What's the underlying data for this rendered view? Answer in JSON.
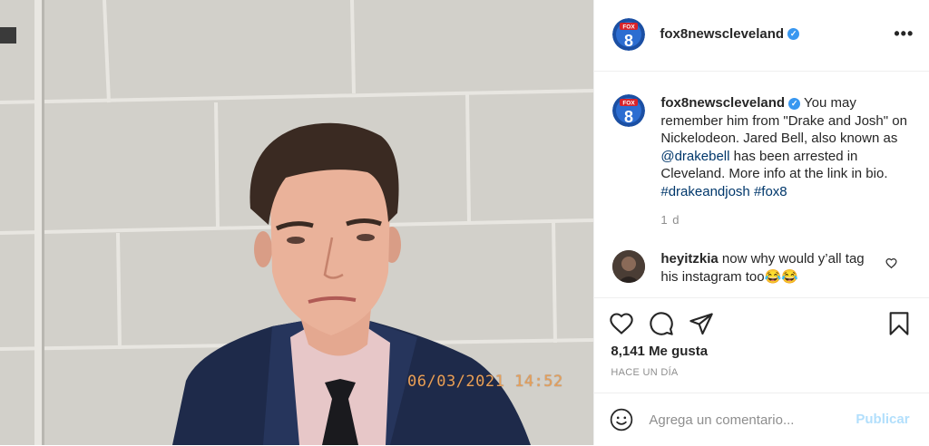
{
  "photo": {
    "timestamp": "06/03/2021 14:52"
  },
  "account": {
    "username": "fox8newscleveland",
    "verified": true,
    "logo_text": "FOX",
    "logo_number": "8"
  },
  "header": {
    "more_label": "•••"
  },
  "caption": {
    "username": "fox8newscleveland",
    "text_before_mention": "You may remember him from \"Drake and Josh\" on Nickelodeon. Jared Bell, also known as ",
    "mention": "@drakebell",
    "text_after_mention": " has been arrested in Cleveland. More info at the link in bio. ",
    "hashtag1": "#drakeandjosh",
    "hashtag2": "#fox8",
    "time_ago": "1 d"
  },
  "comment": {
    "username": "heyitzkia",
    "text": "now why would y’all tag his instagram too😂😂"
  },
  "stats": {
    "likes": "8,141 Me gusta",
    "date": "HACE UN DÍA"
  },
  "compose": {
    "placeholder": "Agrega un comentario...",
    "publish_label": "Publicar"
  },
  "colors": {
    "verified_blue": "#3897f0",
    "link_blue": "#00376b",
    "publish_disabled": "#b2dffc",
    "fox_blue": "#1b4fa3",
    "fox_red": "#d8232a"
  }
}
